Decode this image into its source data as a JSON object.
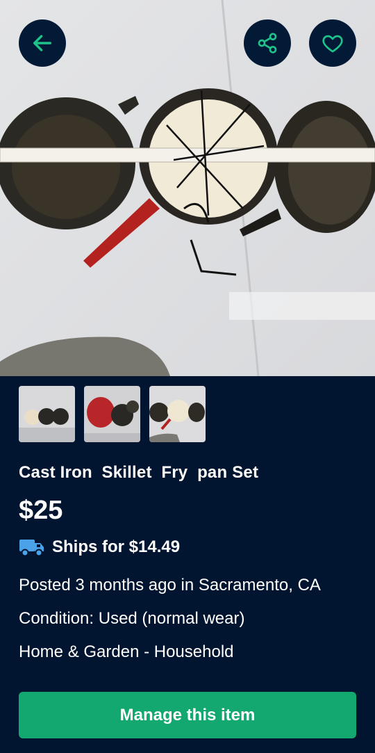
{
  "colors": {
    "background": "#021530",
    "accent": "#12a86f",
    "icon": "#1fc28a"
  },
  "icons": {
    "back": "arrow-left-icon",
    "share": "share-icon",
    "favorite": "heart-icon",
    "shipping": "truck-icon"
  },
  "listing": {
    "title": "Cast Iron  Skillet  Fry  pan Set",
    "price": "$25",
    "shipping": "Ships for $14.49",
    "posted": "Posted 3 months ago in Sacramento, CA",
    "condition": "Condition: Used (normal wear)",
    "category": "Home & Garden - Household"
  },
  "actions": {
    "manage_label": "Manage this item"
  }
}
